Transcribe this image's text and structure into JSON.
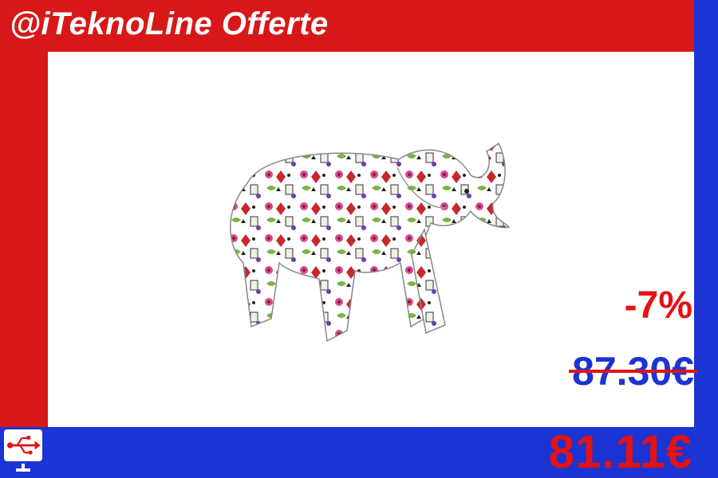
{
  "header": {
    "brand": "@iTeknoLine Offerte"
  },
  "product": {
    "image": "elephant-figurine-image"
  },
  "pricing": {
    "discount": "-7%",
    "old_price": "87.30€",
    "new_price": "81.11€"
  },
  "colors": {
    "brand_red": "#d81818",
    "brand_blue": "#1b34d3",
    "price_red": "#e41212",
    "background": "#ffffff"
  },
  "icons": {
    "logo": "usb-monitor-icon"
  }
}
